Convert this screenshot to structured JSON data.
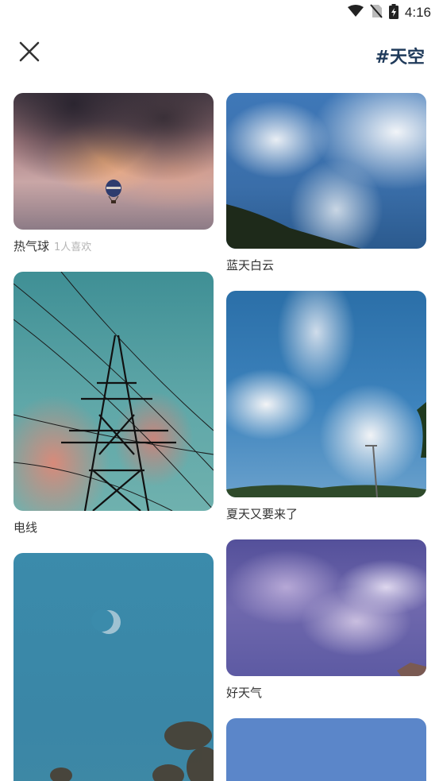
{
  "status_bar": {
    "time": "4:16",
    "icons": [
      "wifi-icon",
      "no-sim-icon",
      "battery-charging-icon"
    ]
  },
  "header": {
    "close_icon": "close-icon",
    "title": "#天空"
  },
  "feed": {
    "left_column": [
      {
        "caption": "热气球",
        "likes": "1人喜欢"
      },
      {
        "caption": "电线",
        "likes": ""
      },
      {
        "caption": "",
        "likes": ""
      }
    ],
    "right_column": [
      {
        "caption": "蓝天白云",
        "likes": ""
      },
      {
        "caption": "夏天又要来了",
        "likes": ""
      },
      {
        "caption": "好天气",
        "likes": ""
      },
      {
        "caption": "",
        "likes": ""
      }
    ]
  },
  "colors": {
    "title": "#1f3a5a",
    "likes_text": "#b5b5b5"
  }
}
